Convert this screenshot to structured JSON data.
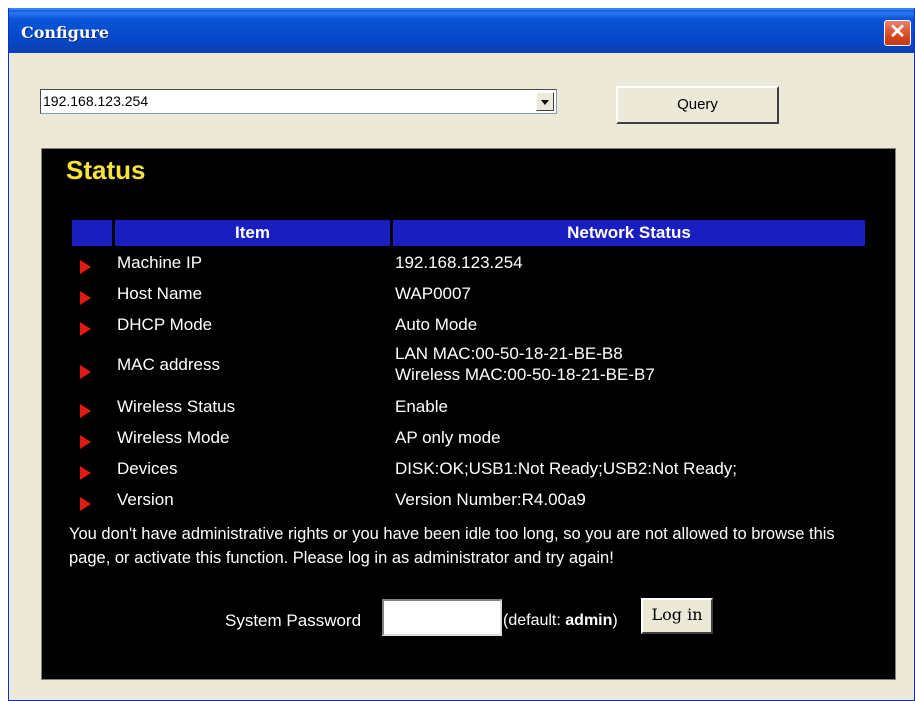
{
  "window": {
    "title": "Configure"
  },
  "toolbar": {
    "ip_value": "192.168.123.254",
    "query_label": "Query"
  },
  "status": {
    "title": "Status",
    "headers": {
      "item": "Item",
      "network_status": "Network Status"
    },
    "rows": [
      {
        "label": "Machine IP",
        "value": "192.168.123.254"
      },
      {
        "label": "Host Name",
        "value": "WAP0007"
      },
      {
        "label": "DHCP Mode",
        "value": "Auto Mode"
      },
      {
        "label": "MAC address",
        "value": "LAN MAC:00-50-18-21-BE-B8",
        "value2": "Wireless MAC:00-50-18-21-BE-B7"
      },
      {
        "label": "Wireless Status",
        "value": "Enable"
      },
      {
        "label": "Wireless Mode",
        "value": "AP only mode"
      },
      {
        "label": "Devices",
        "value": "DISK:OK;USB1:Not Ready;USB2:Not Ready;"
      },
      {
        "label": "Version",
        "value": "Version Number:R4.00a9"
      }
    ],
    "notice": "You don't have administrative rights or you have been idle too long, so you are not allowed to browse this page, or activate this function. Please log in as administrator and try again!",
    "login": {
      "password_label": "System Password",
      "password_value": "",
      "hint_prefix": "(default: ",
      "hint_default": "admin",
      "hint_suffix": ")",
      "login_label": "Log in"
    }
  },
  "colors": {
    "panel_bg": "#000000",
    "header_bg": "#1a1dc0",
    "title_yellow": "#f7e33b",
    "bullet_red": "#e01a10"
  },
  "icons": {
    "close": "close-icon",
    "dropdown": "chevron-down-icon",
    "row_bullet": "triangle-right-icon"
  }
}
